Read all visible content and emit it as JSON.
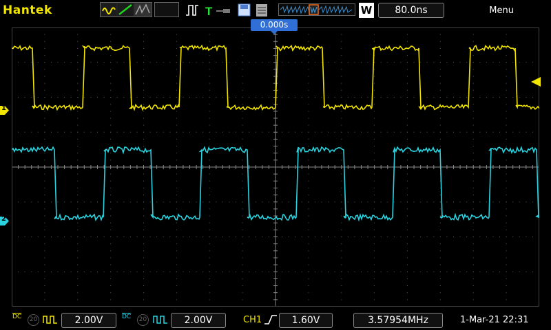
{
  "brand": "Hantek",
  "top": {
    "timebase": "80.0ns",
    "mode_badge": "W",
    "menu": "Menu",
    "trigger_position": "0.000s"
  },
  "channels": {
    "ch1": {
      "marker": "1",
      "color": "#f2e600"
    },
    "ch2": {
      "marker": "2",
      "color": "#29d3e0"
    }
  },
  "bottom": {
    "ch1_coupling": "DC",
    "ch1_bw": "20",
    "ch1_scale": "2.00V",
    "ch2_coupling": "DC",
    "ch2_bw": "20",
    "ch2_scale": "2.00V",
    "trigger_source": "CH1",
    "trigger_level": "1.60V",
    "frequency": "3.57954MHz",
    "datetime": "1-Mar-21 22:31"
  },
  "colors": {
    "ch1": "#f2e600",
    "ch2": "#29d3e0",
    "grid": "#5a5a5a",
    "trigger_marker": "#2f6fd6"
  }
}
